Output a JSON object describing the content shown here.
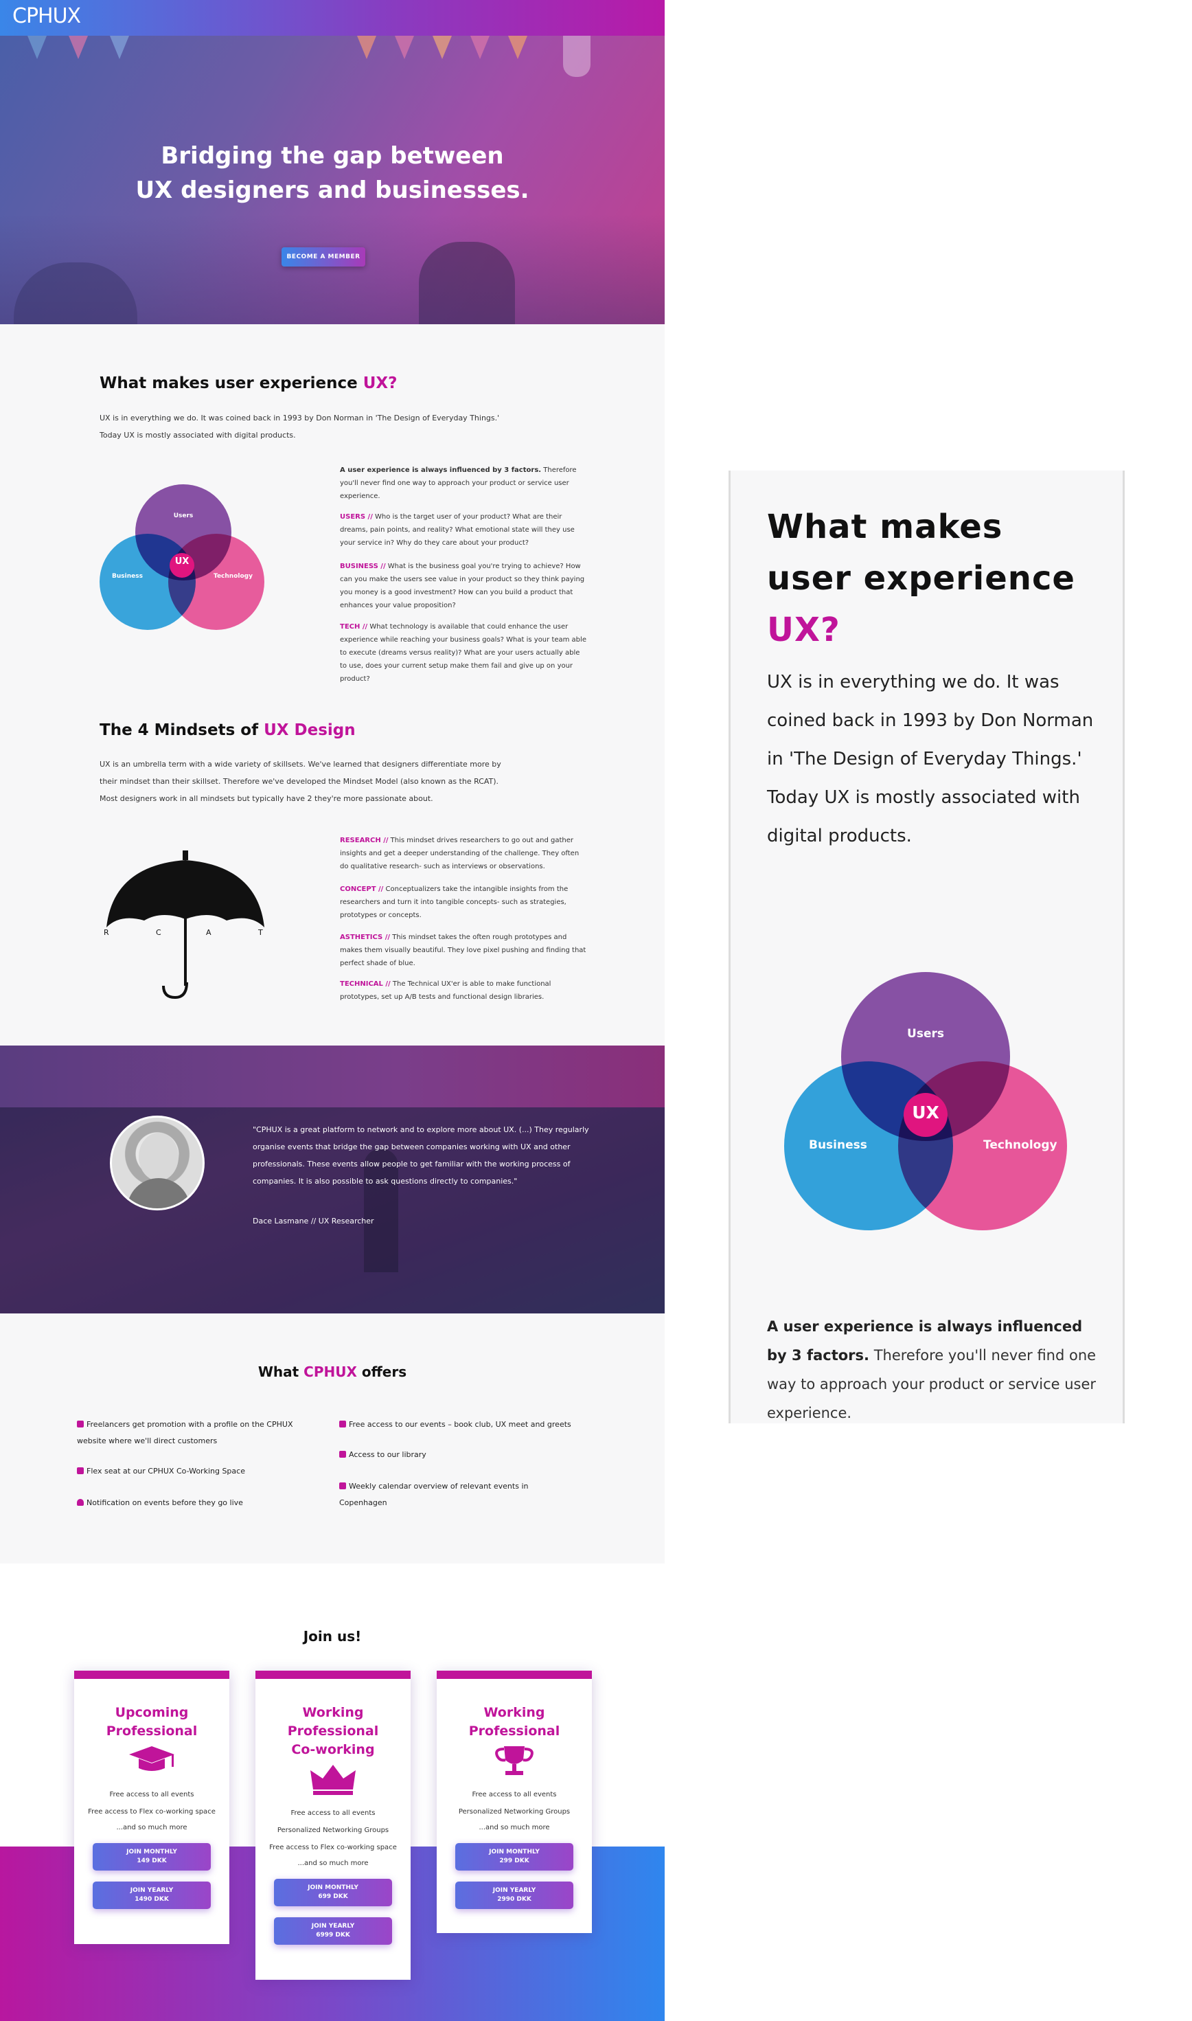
{
  "header": {
    "logo": "CPHUX"
  },
  "hero": {
    "title_line1": "Bridging the gap between",
    "title_line2": "UX designers and businesses.",
    "cta": "BECOME A MEMBER"
  },
  "ux_section": {
    "title": "What makes user experience ",
    "title_accent": "UX?",
    "intro_line1": "UX is in everything we do. It was coined back in 1993 by Don Norman in 'The Design of Everyday Things.'",
    "intro_line2": "Today UX is mostly associated with digital products.",
    "venn": {
      "users": "Users",
      "business": "Business",
      "technology": "Technology",
      "center": "UX"
    },
    "factors_lead": "A user experience is always influenced by 3 factors.",
    "factors_rest": " Therefore you'll never find one way to approach your product or service user experience.",
    "users_label": "USERS //",
    "users_text": " Who is the target user of your product? What are their dreams, pain points, and reality? What emotional state will they use your service in? Why do they care about your product?",
    "business_label": "BUSINESS //",
    "business_text": " What is the business goal you're trying to achieve? How can you make the users see value in your product so they think paying you money is a good investment? How can you build a product that enhances your value proposition?",
    "tech_label": "TECH //",
    "tech_text": " What technology is available that could enhance the user experience while reaching your business goals? What is your team able to execute (dreams versus reality)? What are your users actually able to use, does your current setup make them fail and give up on your product?"
  },
  "mindsets": {
    "title": "The 4 Mindsets of ",
    "title_accent": "UX Design",
    "intro_line1": "UX is an umbrella term with a wide variety of skillsets. We've learned that designers differentiate more by",
    "intro_line2": "their mindset than their skillset. Therefore we've developed the Mindset Model (also known as the RCAT).",
    "intro_line3": "Most designers work in all mindsets but typically have 2 they're more passionate about.",
    "umbrella_letters": [
      "R",
      "C",
      "A",
      "T"
    ],
    "research_label": "RESEARCH //",
    "research_text": " This mindset drives researchers to go out and gather insights and get a deeper understanding of the challenge. They often do qualitative research- such as interviews or observations.",
    "concept_label": "CONCEPT //",
    "concept_text": " Conceptualizers take the intangible insights from the researchers and turn it into tangible concepts- such as strategies, prototypes or concepts.",
    "asthetics_label": "ASTHETICS //",
    "asthetics_text": " This mindset takes the often rough prototypes and makes them visually beautiful. They love pixel pushing and finding that perfect shade of blue.",
    "technical_label": "TECHNICAL //",
    "technical_text": " The Technical UX'er is able to make functional prototypes, set up A/B tests and functional design libraries."
  },
  "quote": {
    "text": "\"CPHUX is a great platform to network and to explore more about UX. (...) They regularly organise events that bridge the gap between companies working with UX and other professionals. These events allow people to get familiar with the working process of companies. It is also possible to ask questions directly to companies.\"",
    "author": "Dace Lasmane // UX Researcher"
  },
  "offers": {
    "title": "What ",
    "title_accent": "CPHUX",
    "title_end": " offers",
    "left": [
      "Freelancers get promotion with a profile on the CPHUX website where we'll direct customers",
      "Flex seat at our CPHUX Co-Working Space",
      "Notification on events before they go live"
    ],
    "right": [
      "Free access to our events – book club, UX meet and greets",
      "Access to our library",
      "Weekly calendar overview of relevant events in Copenhagen"
    ]
  },
  "join": {
    "title": "Join us!",
    "cards": [
      {
        "title": "Upcoming Professional",
        "icon": "graduation-cap-icon",
        "lines": [
          "Free access to all events",
          "Free access to Flex co-working space",
          "...and so much more"
        ],
        "monthly": "JOIN MONTHLY",
        "monthly_price": "149 DKK",
        "yearly": "JOIN YEARLY",
        "yearly_price": "1490 DKK"
      },
      {
        "title": "Working Professional Co-working",
        "icon": "crown-icon",
        "lines": [
          "Free access to all events",
          "Personalized Networking Groups",
          "Free access to Flex co-working space",
          "...and so much more"
        ],
        "monthly": "JOIN MONTHLY",
        "monthly_price": "699 DKK",
        "yearly": "JOIN YEARLY",
        "yearly_price": "6999 DKK"
      },
      {
        "title": "Working Professional",
        "icon": "trophy-icon",
        "lines": [
          "Free access to all events",
          "Personalized Networking Groups",
          "...and so much more"
        ],
        "monthly": "JOIN MONTHLY",
        "monthly_price": "299 DKK",
        "yearly": "JOIN YEARLY",
        "yearly_price": "2990 DKK"
      }
    ]
  },
  "colors": {
    "accent": "#c0149a",
    "blue": "#3a86e8",
    "purple": "#8a3bc0"
  }
}
